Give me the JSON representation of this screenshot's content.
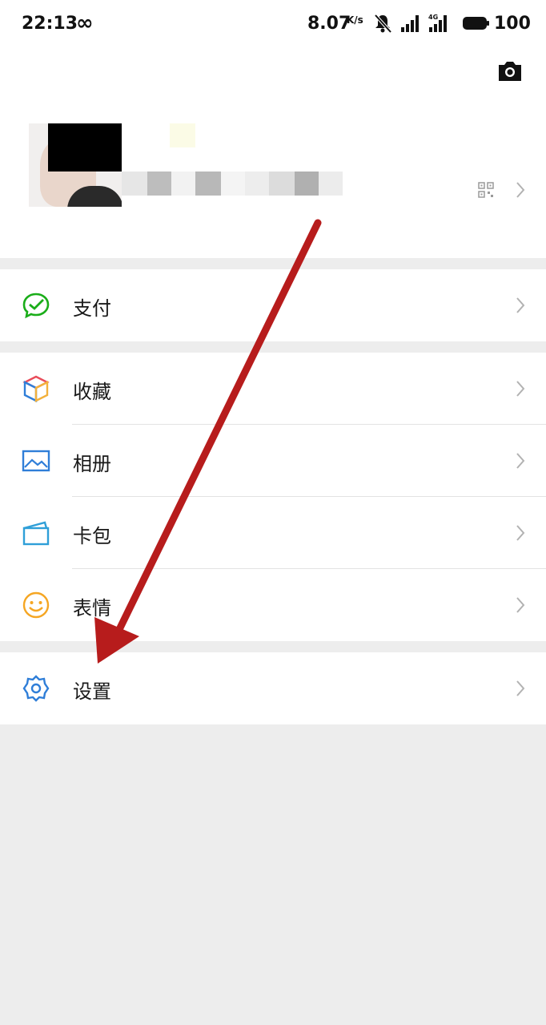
{
  "status_bar": {
    "time": "22:13",
    "infinity": "∞",
    "net_speed": "8.07",
    "net_speed_unit": "K/s",
    "battery": "100"
  },
  "header": {
    "camera_icon": "camera-icon",
    "qr_icon": "qr-code-icon"
  },
  "menu": [
    {
      "label": "支付",
      "icon": "pay-icon",
      "color": "#1aad19"
    },
    {
      "label": "收藏",
      "icon": "favorites-cube-icon",
      "color": "#f3b13c"
    },
    {
      "label": "相册",
      "icon": "album-icon",
      "color": "#2f7ed8"
    },
    {
      "label": "卡包",
      "icon": "card-wallet-icon",
      "color": "#2f9fd8"
    },
    {
      "label": "表情",
      "icon": "sticker-smile-icon",
      "color": "#f5a623"
    },
    {
      "label": "设置",
      "icon": "settings-gear-icon",
      "color": "#2f7ed8"
    }
  ],
  "annotation": {
    "arrow_color": "#b71c1c"
  }
}
